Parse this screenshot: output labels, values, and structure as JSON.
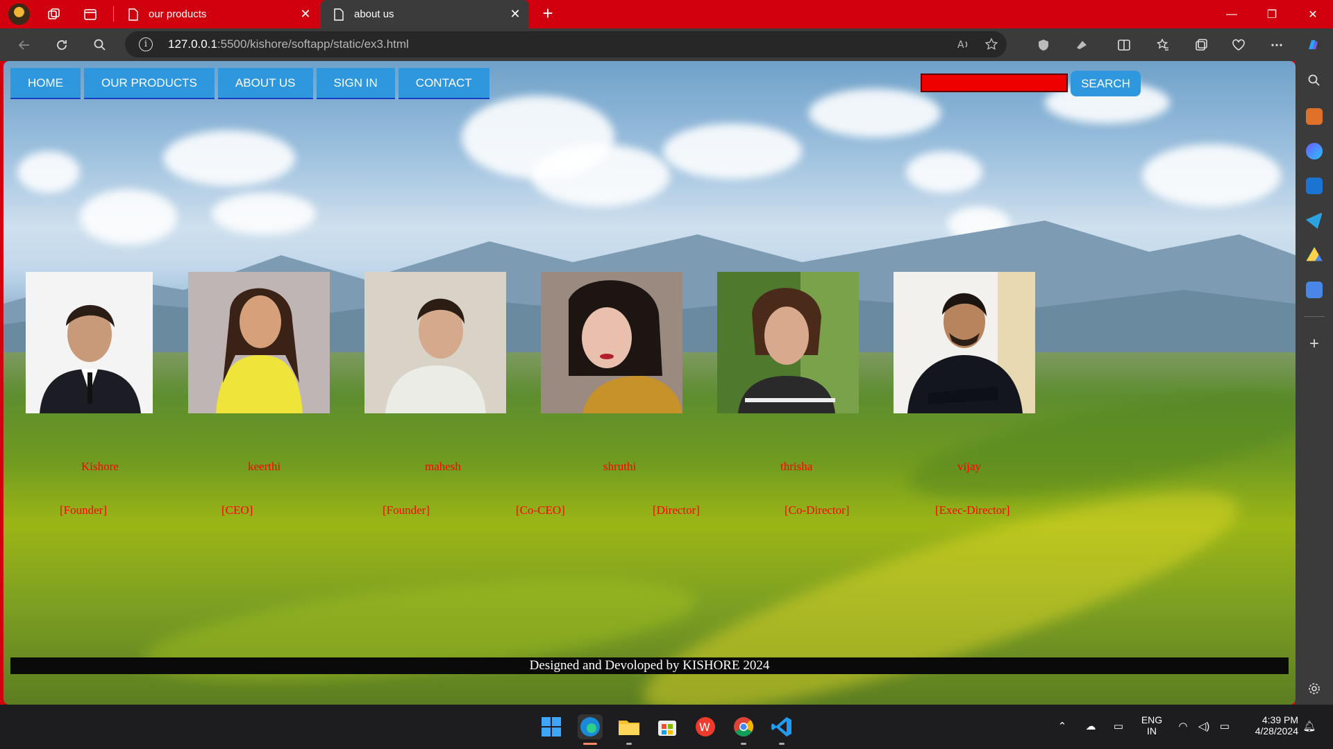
{
  "browser": {
    "tabs": [
      {
        "title": "our products",
        "active": false
      },
      {
        "title": "about us",
        "active": true
      }
    ],
    "tab_close_glyph": "✕",
    "new_tab_glyph": "+",
    "address": {
      "host": "127.0.0.1",
      "rest": ":5500/kishore/softapp/static/ex3.html"
    },
    "window_controls": {
      "minimize": "—",
      "restore": "❐",
      "close": "✕"
    }
  },
  "page": {
    "nav": [
      "HOME",
      "OUR PRODUCTS",
      "ABOUT US",
      "SIGN IN",
      "CONTACT"
    ],
    "search": {
      "value": "",
      "button_label": "SEARCH"
    },
    "team": [
      {
        "name": "Kishore",
        "role": "[Founder]"
      },
      {
        "name": "keerthi",
        "role": "[CEO]"
      },
      {
        "name": "mahesh",
        "role": "[Founder]"
      },
      {
        "name": "shruthi",
        "role": "[Co-CEO]"
      },
      {
        "name": "thrisha",
        "role": "[Director]"
      },
      {
        "name": "vijay",
        "role": "[Co-Director]"
      }
    ],
    "extra_role": "[Exec-Director]",
    "footer": "Designed and Devoloped by KISHORE 2024"
  },
  "taskbar": {
    "language": {
      "line1": "ENG",
      "line2": "IN"
    },
    "time": "4:39 PM",
    "date": "4/28/2024"
  },
  "colors": {
    "chrome_red": "#d0000e",
    "nav_blue": "#2f97de",
    "label_red": "#ff0000",
    "search_red": "#ee0000"
  }
}
